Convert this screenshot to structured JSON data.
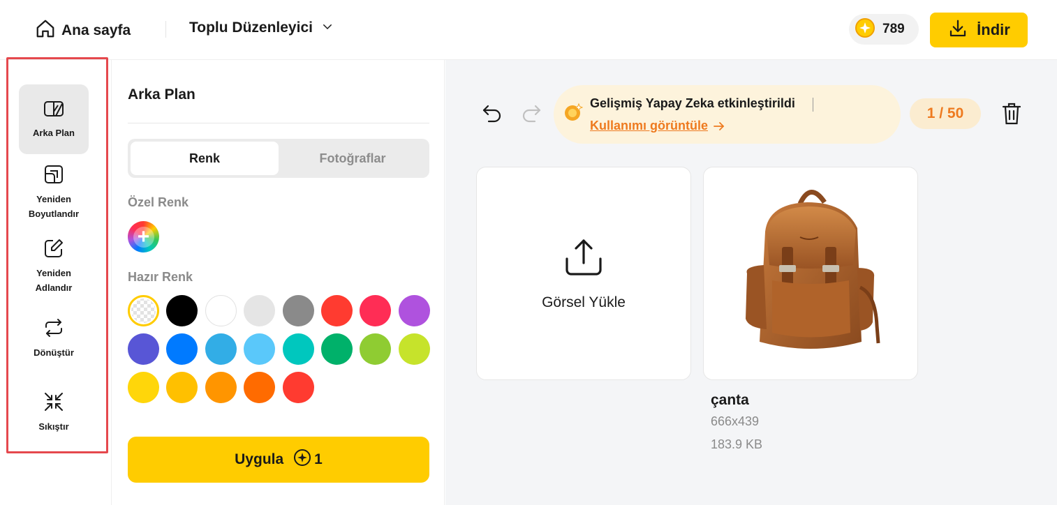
{
  "header": {
    "home_label": "Ana sayfa",
    "editor_label": "Toplu Düzenleyici",
    "credits": "789",
    "download_label": "İndir"
  },
  "rail": {
    "items": [
      {
        "label": "Arka Plan",
        "icon": "background-icon",
        "active": true
      },
      {
        "label": "Yeniden Boyutlandır",
        "icon": "resize-icon"
      },
      {
        "label": "Yeniden Adlandır",
        "icon": "rename-icon"
      },
      {
        "label": "Dönüştür",
        "icon": "convert-icon"
      },
      {
        "label": "Sıkıştır",
        "icon": "compress-icon"
      }
    ]
  },
  "panel": {
    "title": "Arka Plan",
    "tabs": [
      "Renk",
      "Fotoğraflar"
    ],
    "active_tab": "Renk",
    "custom_color_label": "Özel Renk",
    "preset_color_label": "Hazır Renk",
    "preset_colors": [
      "transparent",
      "#000000",
      "#ffffff",
      "#e5e5e5",
      "#8a8a8a",
      "#ff3b30",
      "#ff2d55",
      "#af52de",
      "#5856d6",
      "#007aff",
      "#32ade6",
      "#5ac8fa",
      "#00c7be",
      "#00b16a",
      "#8fcc32",
      "#c6e32b",
      "#ffd60a",
      "#ffc000",
      "#ff9500",
      "#ff6b00",
      "#ff3b30"
    ],
    "apply_label": "Uygula",
    "apply_cost": "1"
  },
  "main": {
    "ai_title": "Gelişmiş Yapay Zeka etkinleştirildi",
    "ai_link": "Kullanımı görüntüle",
    "counter": "1 / 50",
    "upload_label": "Görsel Yükle",
    "file": {
      "name": "çanta",
      "dimensions": "666x439",
      "size": "183.9 KB"
    }
  },
  "colors": {
    "accent": "#ffcc00",
    "orange": "#ee7a1f",
    "highlight": "#e5484d"
  }
}
